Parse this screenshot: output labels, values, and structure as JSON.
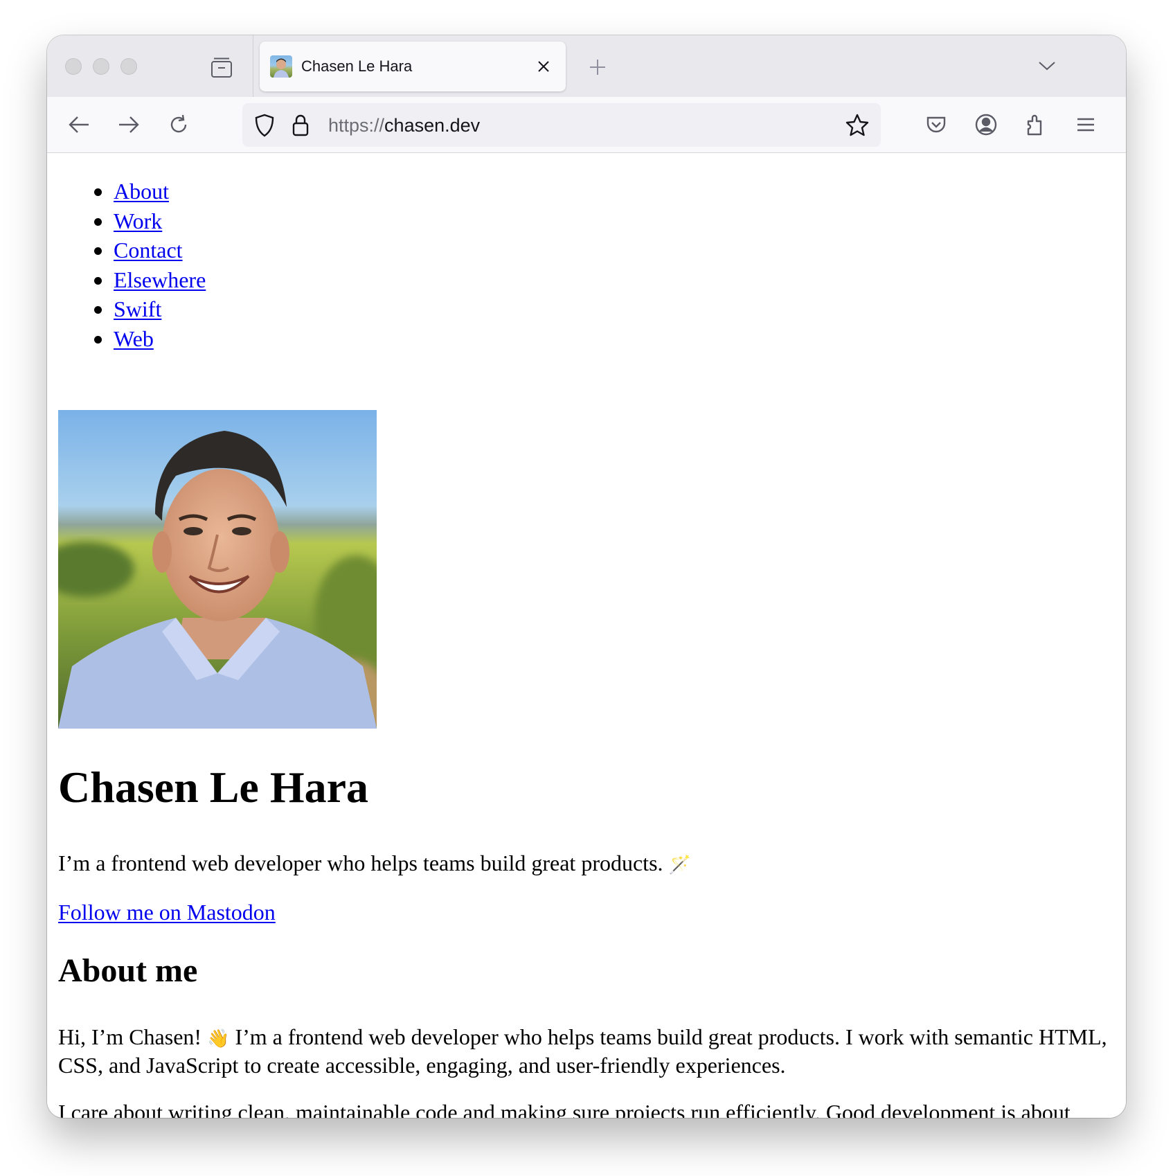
{
  "browser": {
    "tab": {
      "title": "Chasen Le Hara"
    },
    "url": {
      "scheme": "https://",
      "host": "chasen.dev"
    },
    "icons": [
      "tab-overview-icon",
      "close-icon",
      "plus-icon",
      "chevron-down-icon",
      "arrow-left-icon",
      "arrow-right-icon",
      "reload-icon",
      "shield-icon",
      "lock-icon",
      "star-icon",
      "pocket-icon",
      "account-icon",
      "extensions-icon",
      "menu-icon"
    ]
  },
  "nav": {
    "items": [
      {
        "label": "About"
      },
      {
        "label": "Work"
      },
      {
        "label": "Contact"
      },
      {
        "label": "Elsewhere"
      },
      {
        "label": "Swift"
      },
      {
        "label": "Web"
      }
    ]
  },
  "hero": {
    "name": "Chasen Le Hara",
    "tagline": "I’m a frontend web developer who helps teams build great products.",
    "tagline_emoji": "🪄",
    "mastodon_link": "Follow me on Mastodon"
  },
  "about": {
    "heading": "About me",
    "p1_start": "Hi, I’m Chasen!",
    "p1_emoji": "👋",
    "p1_rest": "I’m a frontend web developer who helps teams build great products. I work with semantic HTML, CSS, and JavaScript to create accessible, engaging, and user-friendly experiences.",
    "p2": "I care about writing clean, maintainable code and making sure projects run efficiently. Good development is about more than just code—it’s about collaboration, clear goals, and solving real problems for users."
  },
  "colors": {
    "link": "#0000ee",
    "tabstrip": "#e9e9ed",
    "toolbar": "#f9f9fb",
    "urlbar": "#f0f0f4"
  }
}
